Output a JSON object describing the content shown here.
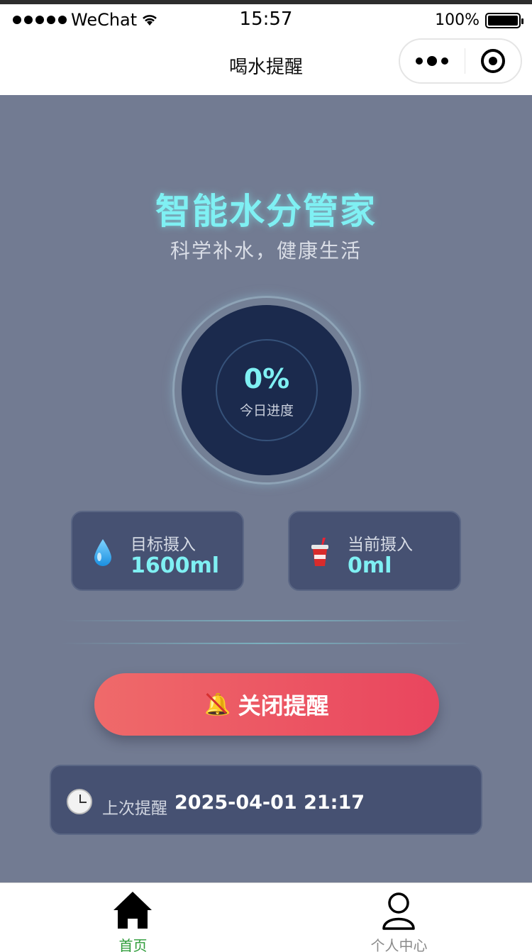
{
  "status_bar": {
    "carrier": "WeChat",
    "time": "15:57",
    "battery": "100%"
  },
  "nav": {
    "title": "喝水提醒"
  },
  "hero": {
    "title": "智能水分管家",
    "subtitle": "科学补水，健康生活"
  },
  "progress": {
    "percent_text": "0%",
    "label": "今日进度",
    "value": 0
  },
  "cards": {
    "target": {
      "icon": "water-drop-icon",
      "label": "目标摄入",
      "value": "1600ml"
    },
    "current": {
      "icon": "cup-icon",
      "label": "当前摄入",
      "value": "0ml"
    }
  },
  "reminder_button": {
    "icon": "bell-off-icon",
    "label": "关闭提醒"
  },
  "last_reminder": {
    "icon": "clock-icon",
    "label": "上次提醒",
    "value": "2025-04-01 21:17"
  },
  "tabbar": {
    "home": {
      "icon": "home-icon",
      "label": "首页",
      "color": "#2e9c3a"
    },
    "me": {
      "icon": "user-icon",
      "label": "个人中心",
      "color": "#8a8a8a"
    }
  },
  "colors": {
    "background": "#727b92",
    "accent": "#7ff0f3",
    "button_start": "#ef6a6a",
    "button_end": "#e9455e",
    "card": "#465172",
    "ring": "#1b2a4d"
  }
}
